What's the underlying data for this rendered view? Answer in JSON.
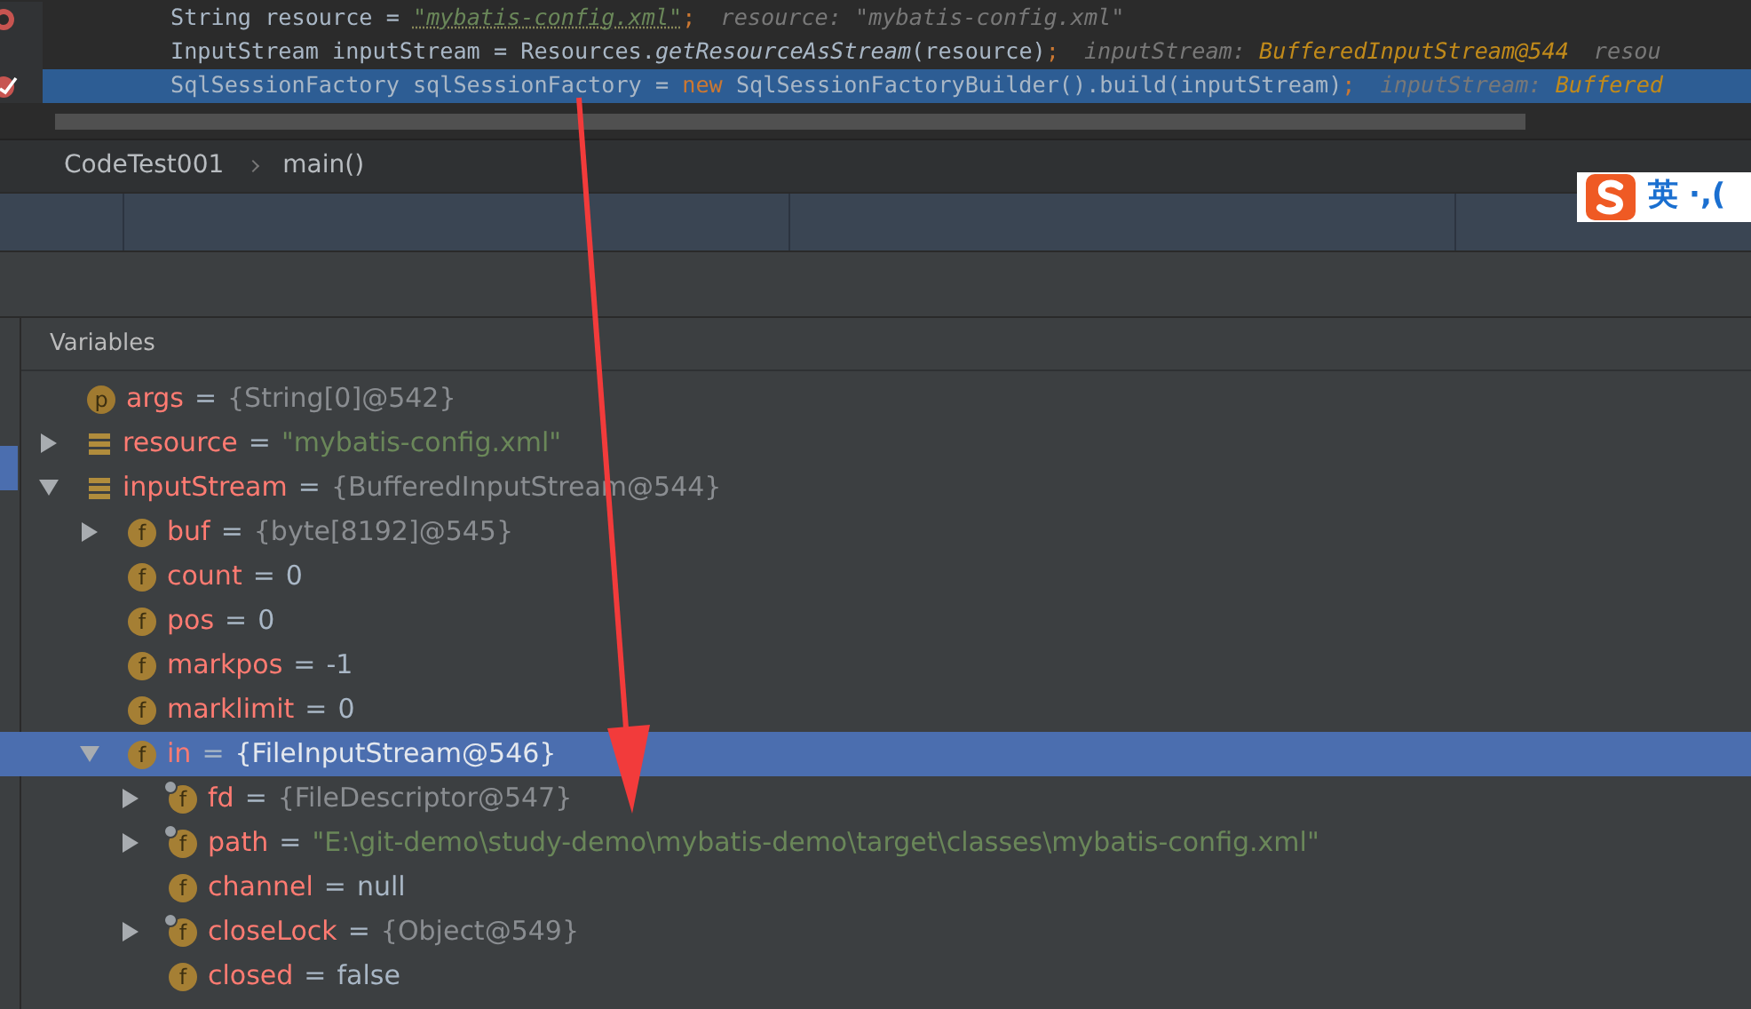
{
  "editor": {
    "lines": [
      {
        "current": false,
        "kind": "breakpoint",
        "tokens": [
          {
            "kind": "plain",
            "text": "String resource = "
          },
          {
            "kind": "string",
            "text": "\"mybatis-config.xml\""
          },
          {
            "kind": "punct",
            "text": ";"
          },
          {
            "kind": "hint",
            "text": "resource: \"mybatis-config.xml\""
          }
        ]
      },
      {
        "current": false,
        "kind": "plain",
        "tokens": [
          {
            "kind": "plain",
            "text": "InputStream inputStream = Resources."
          },
          {
            "kind": "method",
            "text": "getResourceAsStream"
          },
          {
            "kind": "plain",
            "text": "(resource)"
          },
          {
            "kind": "punct",
            "text": ";"
          },
          {
            "kind": "hint",
            "text": "inputStream: "
          },
          {
            "kind": "hint_value",
            "text": "BufferedInputStream@544"
          },
          {
            "kind": "hint",
            "text": "resou"
          }
        ]
      },
      {
        "current": true,
        "kind": "verified_breakpoint",
        "tokens": [
          {
            "kind": "plain",
            "text": "SqlSessionFactory sqlSessionFactory = "
          },
          {
            "kind": "keyword",
            "text": "new"
          },
          {
            "kind": "plain",
            "text": " SqlSessionFactoryBuilder().build(inputStream)"
          },
          {
            "kind": "punct",
            "text": ";"
          },
          {
            "kind": "hint",
            "text": "inputStream: "
          },
          {
            "kind": "hint_value",
            "text": "Buffered"
          }
        ]
      }
    ]
  },
  "breadcrumb": [
    "CodeTest001",
    "main()"
  ],
  "ime": {
    "mode": "英",
    "punct": "·,("
  },
  "variables": {
    "title": "Variables",
    "items": [
      {
        "kind": "parameter",
        "badge": "p",
        "name": "args",
        "equals": "=",
        "value": "{String[0]@542}",
        "quoted": false,
        "reference": true,
        "final": false,
        "selected": false
      },
      {
        "kind": "local",
        "name": "resource",
        "equals": "=",
        "value": "\"mybatis-config.xml\"",
        "quoted": true,
        "reference": false,
        "expanded": false,
        "final": false,
        "selected": false
      },
      {
        "kind": "local",
        "name": "inputStream",
        "equals": "=",
        "value": "{BufferedInputStream@544}",
        "quoted": false,
        "reference": true,
        "expanded": true,
        "final": false,
        "selected": false,
        "children": [
          {
            "kind": "field",
            "badge": "f",
            "name": "buf",
            "equals": "=",
            "value": "{byte[8192]@545}",
            "quoted": false,
            "reference": true,
            "expanded": false,
            "final": false,
            "selected": false
          },
          {
            "kind": "field",
            "badge": "f",
            "name": "count",
            "equals": "=",
            "value": "0",
            "quoted": false,
            "reference": false,
            "final": false,
            "selected": false
          },
          {
            "kind": "field",
            "badge": "f",
            "name": "pos",
            "equals": "=",
            "value": "0",
            "quoted": false,
            "reference": false,
            "final": false,
            "selected": false
          },
          {
            "kind": "field",
            "badge": "f",
            "name": "markpos",
            "equals": "=",
            "value": "-1",
            "quoted": false,
            "reference": false,
            "final": false,
            "selected": false
          },
          {
            "kind": "field",
            "badge": "f",
            "name": "marklimit",
            "equals": "=",
            "value": "0",
            "quoted": false,
            "reference": false,
            "final": false,
            "selected": false
          },
          {
            "kind": "field",
            "badge": "f",
            "name": "in",
            "equals": "=",
            "value": "{FileInputStream@546}",
            "quoted": false,
            "reference": true,
            "expanded": true,
            "final": false,
            "selected": true,
            "children": [
              {
                "kind": "field",
                "badge": "f",
                "name": "fd",
                "equals": "=",
                "value": "{FileDescriptor@547}",
                "quoted": false,
                "reference": true,
                "expanded": false,
                "final": true,
                "selected": false
              },
              {
                "kind": "field",
                "badge": "f",
                "name": "path",
                "equals": "=",
                "value": "\"E:\\git-demo\\study-demo\\mybatis-demo\\target\\classes\\mybatis-config.xml\"",
                "quoted": true,
                "reference": false,
                "expanded": false,
                "final": true,
                "selected": false
              },
              {
                "kind": "field",
                "badge": "f",
                "name": "channel",
                "equals": "=",
                "value": "null",
                "quoted": false,
                "reference": false,
                "final": false,
                "selected": false
              },
              {
                "kind": "field",
                "badge": "f",
                "name": "closeLock",
                "equals": "=",
                "value": "{Object@549}",
                "quoted": false,
                "reference": true,
                "expanded": false,
                "final": true,
                "selected": false
              },
              {
                "kind": "field",
                "badge": "f",
                "name": "closed",
                "equals": "=",
                "value": "false",
                "quoted": false,
                "reference": false,
                "final": false,
                "selected": false
              }
            ]
          }
        ]
      }
    ]
  }
}
